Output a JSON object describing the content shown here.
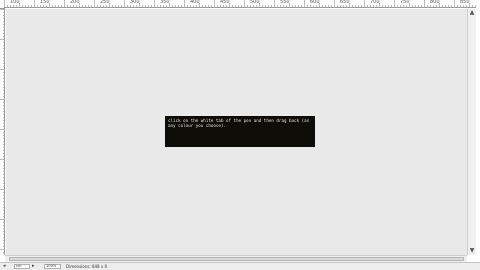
{
  "ruler": {
    "top_labels": [
      "100",
      "150",
      "200",
      "250",
      "300",
      "350",
      "400",
      "450",
      "500",
      "550",
      "600",
      "650",
      "700",
      "750",
      "800",
      "850"
    ]
  },
  "terminal": {
    "text": "click on the white tab of the pen and then drag back (as any colour you choose)."
  },
  "statusbar": {
    "unit_value": "cm",
    "zoom": "100%",
    "info": "Dimensions: 848 x 0"
  },
  "colors": {
    "canvas": "#e9e9e9",
    "terminal_bg": "#0e0c06",
    "terminal_text": "#e8e6da"
  },
  "icons": {
    "scroll_up": "▲",
    "scroll_down": "▼",
    "prev_page": "◂",
    "next_page": "▸"
  }
}
